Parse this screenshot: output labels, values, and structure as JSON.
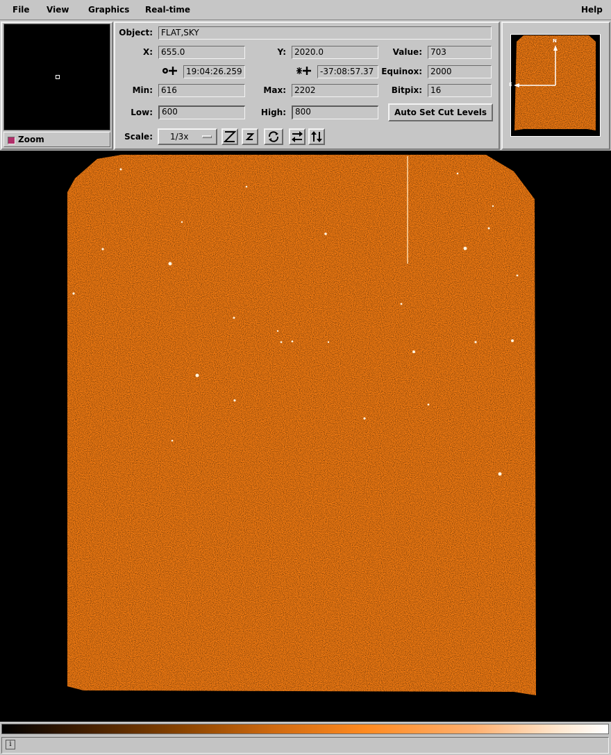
{
  "menu": {
    "file": "File",
    "view": "View",
    "graphics": "Graphics",
    "realtime": "Real-time",
    "help": "Help"
  },
  "zoom": {
    "label": "Zoom"
  },
  "info": {
    "object_label": "Object:",
    "object": "FLAT,SKY",
    "x_label": "X:",
    "x": "655.0",
    "y_label": "Y:",
    "y": "2020.0",
    "value_label": "Value:",
    "value": "703",
    "ra": "19:04:26.259",
    "dec": "-37:08:57.37",
    "equinox_label": "Equinox:",
    "equinox": "2000",
    "min_label": "Min:",
    "min": "616",
    "max_label": "Max:",
    "max": "2202",
    "bitpix_label": "Bitpix:",
    "bitpix": "16",
    "low_label": "Low:",
    "low": "600",
    "high_label": "High:",
    "high": "800",
    "autocut_label": "Auto Set Cut Levels",
    "scale_label": "Scale:",
    "scale": "1/3x"
  },
  "panner": {
    "north": "N",
    "east": "E"
  },
  "status": {
    "info_icon": "i"
  },
  "colors": {
    "image": "#f07a12",
    "colormap_start": "#000000",
    "colormap_end": "#ffffff"
  }
}
